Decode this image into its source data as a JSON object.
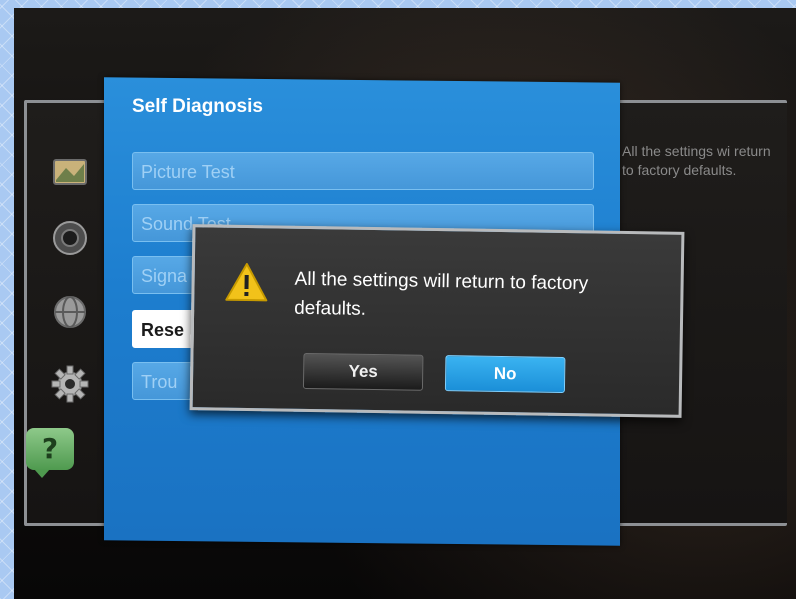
{
  "menu": {
    "title": "Self Diagnosis",
    "items": [
      {
        "label": "Picture Test"
      },
      {
        "label": "Sound Test"
      },
      {
        "label": "Signa"
      },
      {
        "label": "Rese"
      },
      {
        "label": "Trou"
      }
    ],
    "selected_index": 3
  },
  "side_icons": [
    "picture-icon",
    "sound-icon",
    "network-icon",
    "settings-gear-icon",
    "help-icon"
  ],
  "help_icon_glyph": "?",
  "description": "All the settings wi return to factory defaults.",
  "dialog": {
    "message": "All the settings will return to factory defaults.",
    "yes_label": "Yes",
    "no_label": "No",
    "focused": "No"
  },
  "colors": {
    "menu_blue": "#1d7ecf",
    "focus_blue": "#1b8fd8",
    "warning_yellow": "#f2c21a"
  }
}
